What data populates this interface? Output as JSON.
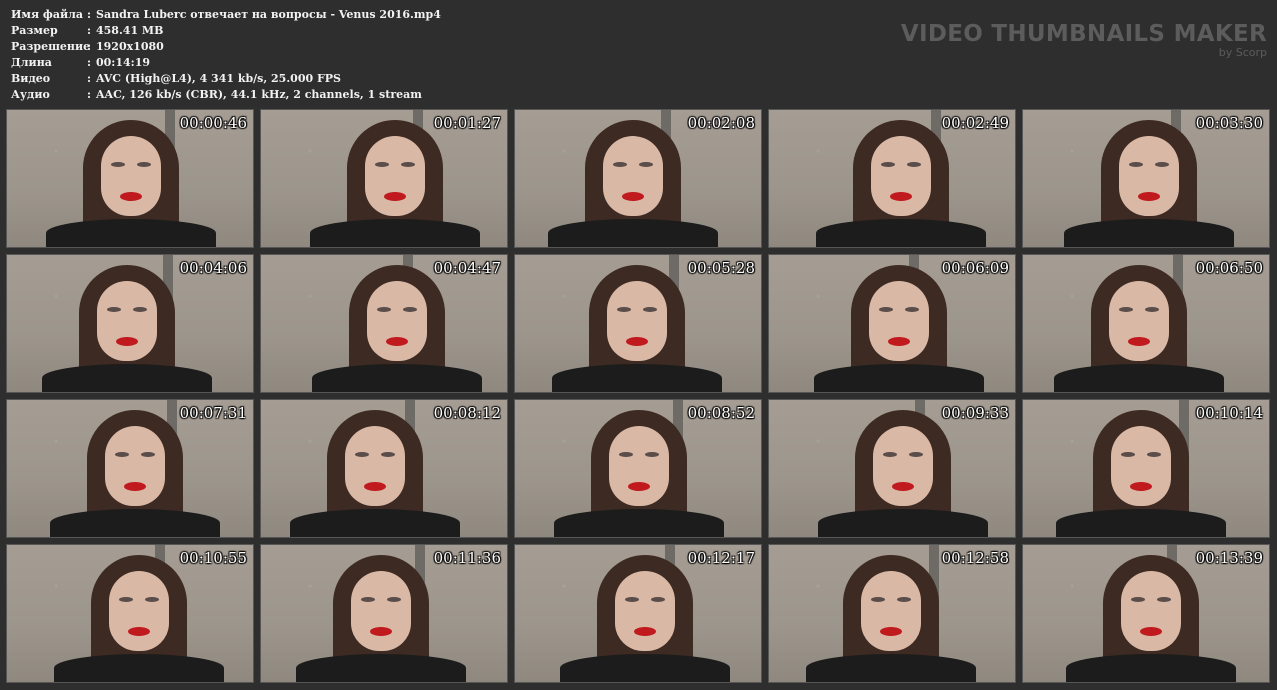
{
  "info": [
    {
      "label": "Имя файла",
      "sep": ":",
      "value": "Sandra Luberc отвечает на вопросы - Venus 2016.mp4"
    },
    {
      "label": "Размер",
      "sep": ":",
      "value": "458.41 MB"
    },
    {
      "label": "Разрешение",
      "sep": ":",
      "value": "1920x1080"
    },
    {
      "label": "Длина",
      "sep": ":",
      "value": "00:14:19"
    },
    {
      "label": "Видео",
      "sep": ":",
      "value": "AVC (High@L4), 4 341 kb/s, 25.000 FPS"
    },
    {
      "label": "Аудио",
      "sep": ":",
      "value": "AAC, 126 kb/s (CBR), 44.1 kHz, 2 channels, 1 stream"
    }
  ],
  "brand": {
    "title": "VIDEO THUMBNAILS MAKER",
    "subtitle": "by Scorp"
  },
  "thumbnails": [
    {
      "time": "00:00:46"
    },
    {
      "time": "00:01:27"
    },
    {
      "time": "00:02:08"
    },
    {
      "time": "00:02:49"
    },
    {
      "time": "00:03:30"
    },
    {
      "time": "00:04:06"
    },
    {
      "time": "00:04:47"
    },
    {
      "time": "00:05:28"
    },
    {
      "time": "00:06:09"
    },
    {
      "time": "00:06:50"
    },
    {
      "time": "00:07:31"
    },
    {
      "time": "00:08:12"
    },
    {
      "time": "00:08:52"
    },
    {
      "time": "00:09:33"
    },
    {
      "time": "00:10:14"
    },
    {
      "time": "00:10:55"
    },
    {
      "time": "00:11:36"
    },
    {
      "time": "00:12:17"
    },
    {
      "time": "00:12:58"
    },
    {
      "time": "00:13:39"
    }
  ]
}
